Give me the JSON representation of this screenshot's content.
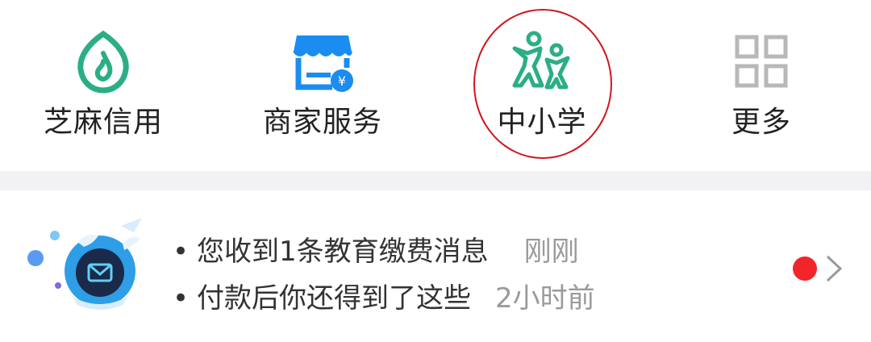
{
  "grid": {
    "items": [
      {
        "label": "芝麻信用",
        "icon": "sesame-credit-icon",
        "color": "#2bae86"
      },
      {
        "label": "商家服务",
        "icon": "merchant-store-icon",
        "color": "#1b8cf0"
      },
      {
        "label": "中小学",
        "icon": "school-kids-icon",
        "color": "#2bae86"
      },
      {
        "label": "更多",
        "icon": "grid-more-icon",
        "color": "#b8b8b8"
      }
    ],
    "highlight_color": "#d0161c"
  },
  "messages": {
    "avatar_icon": "education-bot-icon",
    "lines": [
      {
        "text": "您收到1条教育缴费消息",
        "time": "刚刚"
      },
      {
        "text": "付款后你还得到了这些",
        "time": "2小时前"
      }
    ],
    "bullet": "•",
    "unread_dot_color": "#f2262a",
    "arrow_icon": "chevron-right-icon"
  }
}
